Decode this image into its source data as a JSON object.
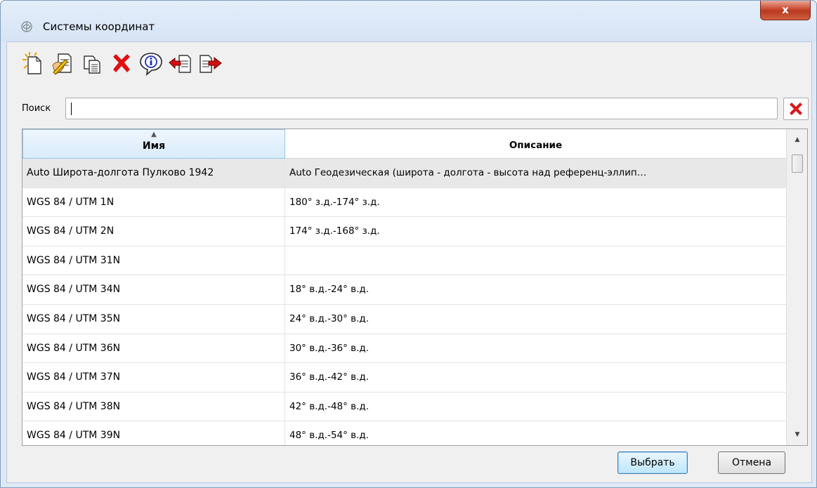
{
  "window": {
    "title": "Системы координат",
    "close_glyph": "x"
  },
  "toolbar": {
    "buttons": [
      {
        "icon": "new-document-icon"
      },
      {
        "icon": "edit-document-icon"
      },
      {
        "icon": "copy-icon"
      },
      {
        "icon": "delete-icon",
        "color": "#e01010"
      },
      {
        "icon": "info-icon",
        "color": "#1a30c0"
      },
      {
        "icon": "import-icon"
      },
      {
        "icon": "export-icon"
      }
    ]
  },
  "search": {
    "label": "Поиск",
    "value": "",
    "clear_icon": "clear-icon"
  },
  "table": {
    "columns": [
      "Имя",
      "Описание"
    ],
    "sort_column": "Имя",
    "sort_glyph": "▲",
    "rows": [
      {
        "name": "Auto Широта-долгота Пулково 1942",
        "description": "Auto Геодезическая (широта - долгота - высота над референц-эллип…"
      },
      {
        "name": "WGS 84 / UTM 1N",
        "description": "180° з.д.-174° з.д."
      },
      {
        "name": "WGS 84 / UTM 2N",
        "description": "174° з.д.-168° з.д."
      },
      {
        "name": "WGS 84 / UTM 31N",
        "description": ""
      },
      {
        "name": "WGS 84 / UTM 34N",
        "description": "18° в.д.-24° в.д."
      },
      {
        "name": "WGS 84 / UTM 35N",
        "description": "24° в.д.-30° в.д."
      },
      {
        "name": "WGS 84 / UTM 36N",
        "description": "30° в.д.-36° в.д."
      },
      {
        "name": "WGS 84 / UTM 37N",
        "description": "36° в.д.-42° в.д."
      },
      {
        "name": "WGS 84 / UTM 38N",
        "description": "42° в.д.-48° в.д."
      },
      {
        "name": "WGS 84 / UTM 39N",
        "description": "48° в.д.-54° в.д."
      }
    ],
    "selected_row": 0
  },
  "footer": {
    "ok_label": "Выбрать",
    "cancel_label": "Отмена"
  },
  "colors": {
    "accent": "#3c7fb1",
    "close_button": "#c9482e",
    "selection": "#e8e8e8"
  }
}
